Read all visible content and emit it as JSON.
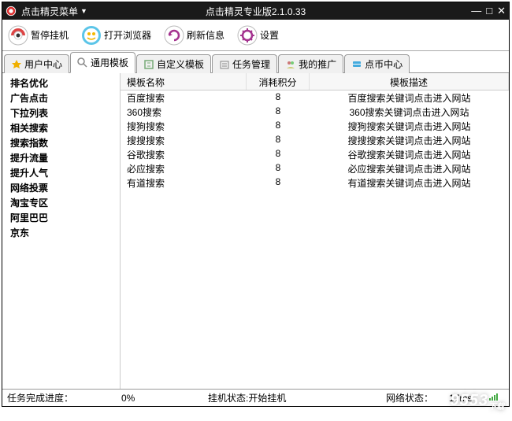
{
  "titlebar": {
    "menu_label": "点击精灵菜单",
    "title": "点击精灵专业版2.1.0.33"
  },
  "toolbar": [
    {
      "id": "pause",
      "label": "暂停挂机"
    },
    {
      "id": "browser",
      "label": "打开浏览器"
    },
    {
      "id": "refresh",
      "label": "刷新信息"
    },
    {
      "id": "settings",
      "label": "设置"
    }
  ],
  "tabs": [
    {
      "id": "user-center",
      "label": "用户中心",
      "active": false
    },
    {
      "id": "general-template",
      "label": "通用模板",
      "active": true
    },
    {
      "id": "custom-template",
      "label": "自定义模板",
      "active": false
    },
    {
      "id": "task-mgr",
      "label": "任务管理",
      "active": false
    },
    {
      "id": "my-promo",
      "label": "我的推广",
      "active": false
    },
    {
      "id": "coin-center",
      "label": "点币中心",
      "active": false
    }
  ],
  "sidebar": {
    "items": [
      "排名优化",
      "广告点击",
      "下拉列表",
      "相关搜索",
      "搜索指数",
      "提升流量",
      "提升人气",
      "网络投票",
      "淘宝专区",
      "阿里巴巴",
      "京东"
    ]
  },
  "table": {
    "columns": [
      "模板名称",
      "消耗积分",
      "模板描述"
    ],
    "rows": [
      {
        "name": "百度搜索",
        "cost": "8",
        "desc": "百度搜索关键词点击进入网站"
      },
      {
        "name": "360搜索",
        "cost": "8",
        "desc": "360搜索关键词点击进入网站"
      },
      {
        "name": "搜狗搜索",
        "cost": "8",
        "desc": "搜狗搜索关键词点击进入网站"
      },
      {
        "name": "搜搜搜索",
        "cost": "8",
        "desc": "搜搜搜索关键词点击进入网站"
      },
      {
        "name": "谷歌搜索",
        "cost": "8",
        "desc": "谷歌搜索关键词点击进入网站"
      },
      {
        "name": "必应搜索",
        "cost": "8",
        "desc": "必应搜索关键词点击进入网站"
      },
      {
        "name": "有道搜索",
        "cost": "8",
        "desc": "有道搜索关键词点击进入网站"
      }
    ]
  },
  "status": {
    "progress_label": "任务完成进度：",
    "progress_value": "0%",
    "idle_label": "挂机状态:开始挂机",
    "net_label": "网络状态：",
    "latency": "17ms"
  },
  "watermark": "9553"
}
